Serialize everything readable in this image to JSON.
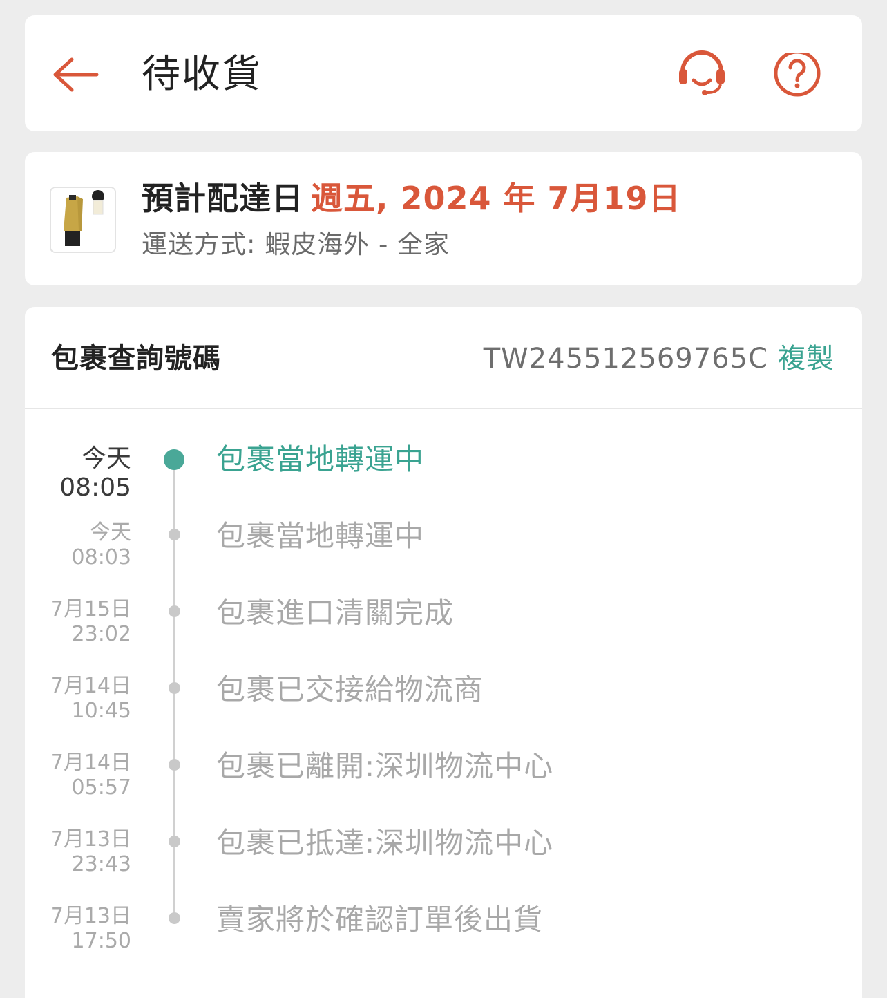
{
  "header": {
    "title": "待收貨",
    "back_icon": "arrow-left-icon",
    "support_icon": "headset-icon",
    "help_icon": "question-circle-icon"
  },
  "delivery": {
    "eta_label": "預計配達日",
    "eta_date": "週五, 2024 年 7月19日",
    "shipping_method": "運送方式: 蝦皮海外 - 全家"
  },
  "tracking": {
    "label": "包裹查詢號碼",
    "number": "TW245512569765C",
    "copy_label": "複製",
    "events": [
      {
        "date": "今天",
        "time": "08:05",
        "status": "包裹當地轉運中"
      },
      {
        "date": "今天",
        "time": "08:03",
        "status": "包裹當地轉運中"
      },
      {
        "date": "7月15日",
        "time": "23:02",
        "status": "包裹進口清關完成"
      },
      {
        "date": "7月14日",
        "time": "10:45",
        "status": "包裹已交接給物流商"
      },
      {
        "date": "7月14日",
        "time": "05:57",
        "status": "包裹已離開:深圳物流中心"
      },
      {
        "date": "7月13日",
        "time": "23:43",
        "status": "包裹已抵達:深圳物流中心"
      },
      {
        "date": "7月13日",
        "time": "17:50",
        "status": "賣家將於確認訂單後出貨"
      }
    ]
  },
  "colors": {
    "accent_orange": "#d9573a",
    "accent_teal": "#3aa391",
    "background": "#ededed"
  }
}
